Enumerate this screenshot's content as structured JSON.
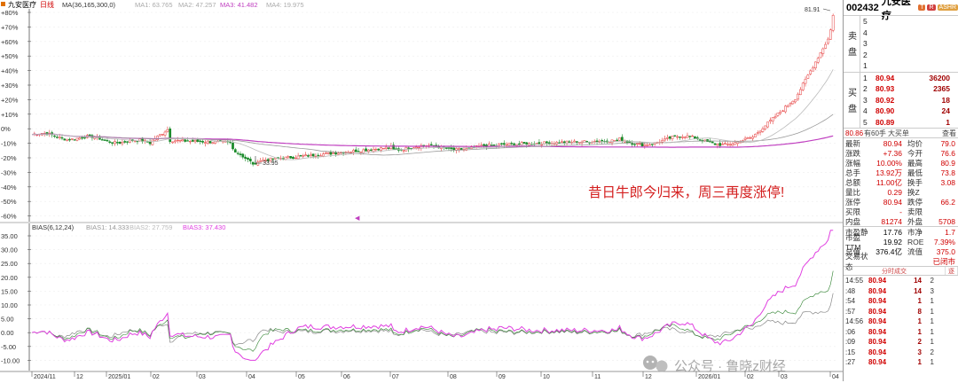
{
  "main_header": {
    "name": "九安医疗",
    "flag": "日线",
    "ma_params": "MA(36,165,300,0)",
    "ma1": "MA1: 63.765",
    "ma2": "MA2: 47.257",
    "ma3": "MA3: 41.482",
    "ma4": "MA4: 19.975"
  },
  "y_axis_main": [
    "+80%",
    "+70%",
    "+60%",
    "+50%",
    "+40%",
    "+30%",
    "+20%",
    "+10%",
    "0%",
    "-10%",
    "-20%",
    "-30%",
    "-40%",
    "-50%",
    "-60%"
  ],
  "high_marker": "81.91",
  "low_marker": "33.95",
  "annotation": "昔日牛郎今归来，周三再度涨停!",
  "bias_header": {
    "name": "BIAS(6,12,24)",
    "b1": "BIAS1: 14.333",
    "b2": "BIAS2: 27.759",
    "b3": "BIAS3: 37.430"
  },
  "y_axis_bias": [
    "35.00",
    "30.00",
    "25.00",
    "20.00",
    "15.00",
    "10.00",
    "5.00",
    "0.00",
    "-5.00",
    "-10.00"
  ],
  "x_axis": [
    "2024/11",
    "12",
    "2025/01",
    "02",
    "03",
    "04",
    "05",
    "06",
    "07",
    "08",
    "09",
    "10",
    "11",
    "12",
    "2026/01",
    "02",
    "03",
    "04"
  ],
  "watermark": "公众号 · 鲁晓z财经",
  "colors": {
    "up": "#e53b3b",
    "down": "#1a8a2a",
    "ma_purple": "#c040c0",
    "ma_gray": "#888888",
    "bias1": "#888888",
    "bias2": "#2a7f2a",
    "bias3": "#e040e0"
  },
  "panel": {
    "code": "002432",
    "name": "九安医疗",
    "badges": [
      "T",
      "R",
      "ASHR"
    ],
    "sell_label": [
      "卖",
      "盘"
    ],
    "buy_label": [
      "买",
      "盘"
    ],
    "sell": [
      {
        "lv": "5",
        "p": "",
        "v": ""
      },
      {
        "lv": "4",
        "p": "",
        "v": ""
      },
      {
        "lv": "3",
        "p": "",
        "v": ""
      },
      {
        "lv": "2",
        "p": "",
        "v": ""
      },
      {
        "lv": "1",
        "p": "",
        "v": ""
      }
    ],
    "buy": [
      {
        "lv": "1",
        "p": "80.94",
        "v": "36200"
      },
      {
        "lv": "2",
        "p": "80.93",
        "v": "2365"
      },
      {
        "lv": "3",
        "p": "80.92",
        "v": "18"
      },
      {
        "lv": "4",
        "p": "80.90",
        "v": "24"
      },
      {
        "lv": "5",
        "p": "80.89",
        "v": "1"
      }
    ],
    "strip": {
      "a": "80.86",
      "b": "有60手",
      "c": "大买单",
      "d": "查看"
    },
    "quotes": [
      {
        "k": "最新",
        "v": "80.94",
        "k2": "均价",
        "v2": "79.0"
      },
      {
        "k": "涨跌",
        "v": "+7.36",
        "k2": "今开",
        "v2": "76.6"
      },
      {
        "k": "涨幅",
        "v": "10.00%",
        "k2": "最高",
        "v2": "80.9"
      },
      {
        "k": "总手",
        "v": "13.92万",
        "k2": "最低",
        "v2": "73.8"
      },
      {
        "k": "总额",
        "v": "11.00亿",
        "k2": "换手",
        "v2": "3.08"
      },
      {
        "k": "量比",
        "v": "0.29",
        "k2": "换Z",
        "v2": ""
      },
      {
        "k": "涨停",
        "v": "80.94",
        "k2": "跌停",
        "v2": "66.2"
      },
      {
        "k": "买限",
        "v": "-",
        "k2": "卖限",
        "v2": ""
      },
      {
        "k": "内盘",
        "v": "81274",
        "k2": "外盘",
        "v2": "5708"
      }
    ],
    "fund": [
      {
        "k": "市盈静",
        "v": "17.76",
        "k2": "市净",
        "v2": "1.7"
      },
      {
        "k": "市盈TTM",
        "v": "19.92",
        "k2": "ROE",
        "v2": "7.39%"
      },
      {
        "k": "总值",
        "v": "376.4亿",
        "k2": "流值",
        "v2": "375.0"
      },
      {
        "k": "交易状态",
        "v": "",
        "k2": "",
        "v2": "已闭市"
      }
    ],
    "tabs": [
      "分时成交",
      "逐"
    ],
    "ticks": [
      {
        "t": "14:55",
        "p": "80.94",
        "n": "14",
        "c": "2"
      },
      {
        "t": ":48",
        "p": "80.94",
        "n": "14",
        "c": "3"
      },
      {
        "t": ":54",
        "p": "80.94",
        "n": "1",
        "c": "1"
      },
      {
        "t": ":57",
        "p": "80.94",
        "n": "8",
        "c": "1"
      },
      {
        "t": "14:56",
        "p": "80.94",
        "n": "1",
        "c": "1"
      },
      {
        "t": ":06",
        "p": "80.94",
        "n": "1",
        "c": "1"
      },
      {
        "t": ":09",
        "p": "80.94",
        "n": "2",
        "c": "1"
      },
      {
        "t": ":15",
        "p": "80.94",
        "n": "3",
        "c": "2"
      },
      {
        "t": ":27",
        "p": "80.94",
        "n": "1",
        "c": "1"
      }
    ]
  }
}
